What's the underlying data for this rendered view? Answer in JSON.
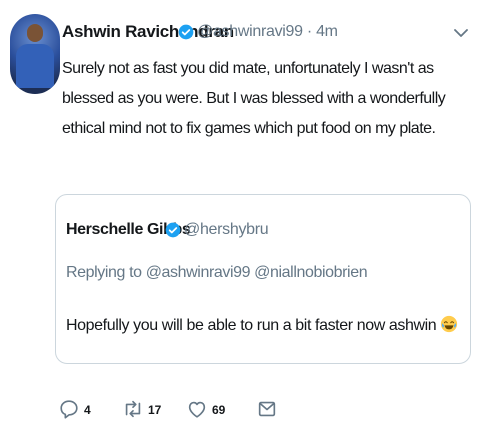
{
  "tweet": {
    "author_name": "Ashwin Ravichandran",
    "handle": "@ashwinravi99",
    "time": "· 4m",
    "text": "Surely not as fast you did mate, unfortunately I wasn't as blessed as you were. But I was blessed with a wonderfully ethical mind not to fix games which put food on my plate."
  },
  "quoted": {
    "author_name": "Herschelle Gibbs",
    "handle": "@hershybru",
    "replying_prefix": "Replying to",
    "replying_to": "@ashwinravi99 @niallnobiobrien",
    "text": "Hopefully you will be able to run a bit faster now ashwin"
  },
  "actions": {
    "reply_count": "4",
    "retweet_count": "17",
    "like_count": "69"
  },
  "icons": [
    "verified-icon",
    "chevron-down-icon",
    "reply-icon",
    "retweet-icon",
    "like-icon",
    "message-icon",
    "laughing-emoji-icon"
  ],
  "colors": {
    "verified": "#1da1f2",
    "muted": "#657786",
    "text": "#14171a",
    "border": "#ccd6dd"
  }
}
